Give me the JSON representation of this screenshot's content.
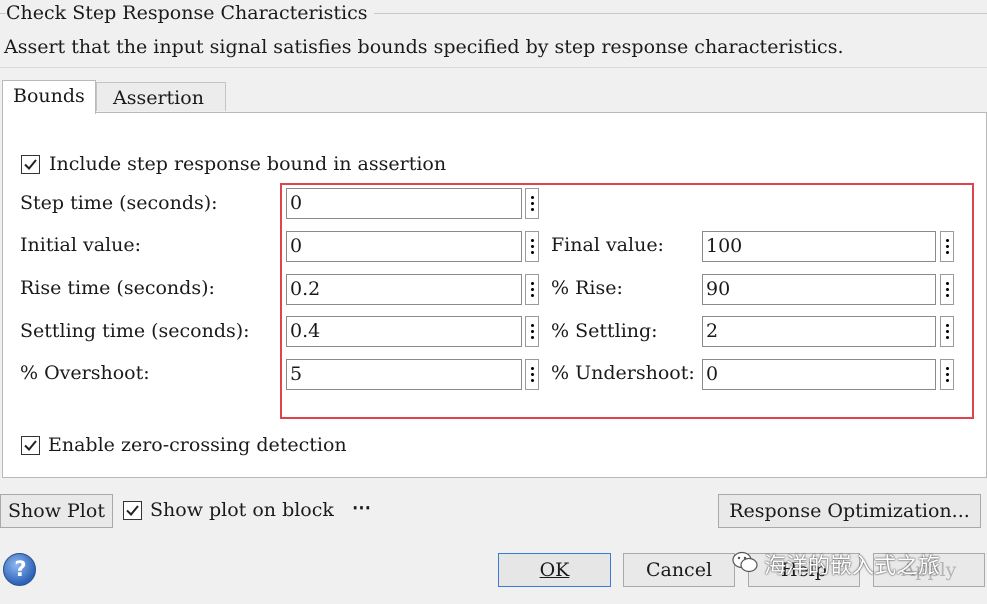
{
  "dialog": {
    "group_title": "Check Step Response Characteristics",
    "description": "Assert that the input signal satisfies bounds specified by step response characteristics."
  },
  "tabs": [
    {
      "label": "Bounds",
      "active": true
    },
    {
      "label": "Assertion",
      "active": false
    }
  ],
  "bounds": {
    "include_checkbox": {
      "label": "Include step response bound in assertion",
      "checked": true
    },
    "step_time": {
      "label": "Step time (seconds):",
      "value": "0"
    },
    "initial_value": {
      "label": "Initial value:",
      "value": "0"
    },
    "final_value": {
      "label": "Final value:",
      "value": "100"
    },
    "rise_time": {
      "label": "Rise time (seconds):",
      "value": "0.2"
    },
    "percent_rise": {
      "label": "% Rise:",
      "value": "90"
    },
    "settling_time": {
      "label": "Settling time (seconds):",
      "value": "0.4"
    },
    "percent_settling": {
      "label": "% Settling:",
      "value": "2"
    },
    "percent_overshoot": {
      "label": "% Overshoot:",
      "value": "5"
    },
    "percent_undershoot": {
      "label": "% Undershoot:",
      "value": "0"
    },
    "zero_crossing_checkbox": {
      "label": "Enable zero-crossing detection",
      "checked": true
    }
  },
  "plot_row": {
    "show_plot_button": "Show Plot",
    "show_plot_on_block": {
      "label": "Show plot on block",
      "checked": true
    },
    "more_glyph": "⋯",
    "response_optimization_button": "Response Optimization..."
  },
  "footer": {
    "help_glyph": "?",
    "ok_button": "OK",
    "cancel_button": "Cancel",
    "help_button": "Help",
    "apply_button": "Apply"
  },
  "watermark": {
    "text": "海洋的嵌入式之旅",
    "icon": "wechat-icon"
  },
  "colors": {
    "highlight_box": "#e0434a",
    "ok_focus": "#3b7bd8",
    "panel_bg": "#ffffff",
    "window_bg": "#f0f0f0"
  }
}
